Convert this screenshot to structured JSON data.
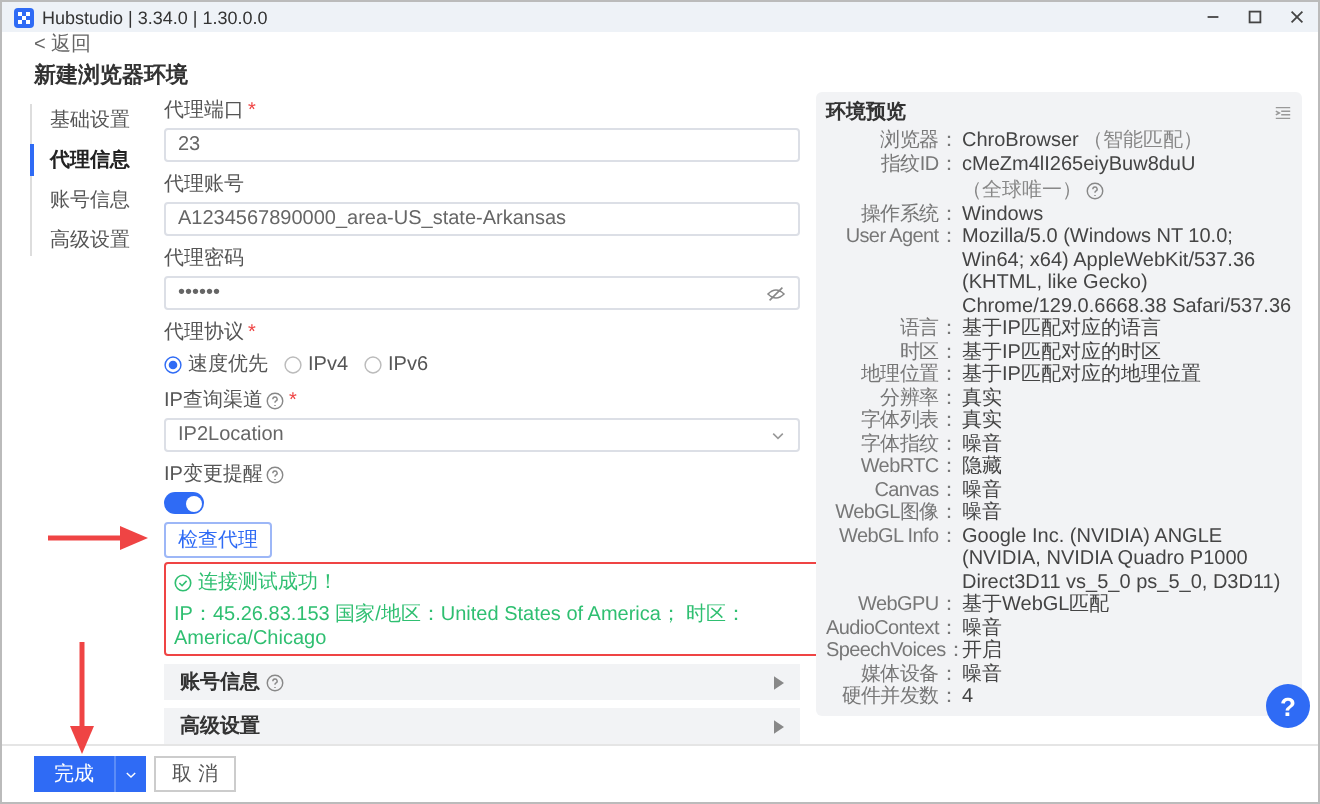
{
  "window": {
    "title": "Hubstudio | 3.34.0 | 1.30.0.0"
  },
  "back_link": "< 返回",
  "page_title": "新建浏览器环境",
  "nav": [
    {
      "label": "基础设置",
      "selected": false
    },
    {
      "label": "代理信息",
      "selected": true
    },
    {
      "label": "账号信息",
      "selected": false
    },
    {
      "label": "高级设置",
      "selected": false
    }
  ],
  "form": {
    "fields": [
      {
        "kind": "input",
        "label": "代理端口",
        "required_mark": "*",
        "value": "23"
      },
      {
        "kind": "input",
        "label": "代理账号",
        "value": "A1234567890000_area-US_state-Arkansas"
      },
      {
        "kind": "password",
        "label": "代理密码",
        "value": "••••••"
      },
      {
        "kind": "radio",
        "label": "代理协议",
        "required_mark": "*",
        "options": [
          {
            "label": "速度优先",
            "selected": true
          },
          {
            "label": "IPv4",
            "selected": false
          },
          {
            "label": "IPv6",
            "selected": false
          }
        ]
      },
      {
        "kind": "select",
        "label": "IP查询渠道",
        "help": true,
        "required_mark": "*",
        "value": "IP2Location"
      },
      {
        "kind": "toggle",
        "label": "IP变更提醒",
        "help": true,
        "on": true
      }
    ],
    "check_button": "检查代理",
    "check_result": {
      "status": "连接测试成功！",
      "details": "IP：45.26.83.153 国家/地区：United States of America； 时区：America/Chicago"
    },
    "sections": [
      {
        "title": "账号信息",
        "help": true,
        "expanded": false
      },
      {
        "title": "高级设置",
        "expanded": false
      }
    ]
  },
  "preview": {
    "title": "环境预览",
    "rows": [
      {
        "label": "浏览器：",
        "value": "ChroBrowser",
        "note": "（智能匹配）"
      },
      {
        "label": "指纹ID：",
        "value": "cMeZm4lI265eiyBuw8duU",
        "note": "（全球唯一）",
        "help": true
      },
      {
        "label": "操作系统：",
        "value": "Windows"
      },
      {
        "label": "User Agent：",
        "value": "Mozilla/5.0 (Windows NT 10.0; Win64; x64) AppleWebKit/537.36 (KHTML, like Gecko) Chrome/129.0.6668.38 Safari/537.36"
      },
      {
        "label": "语言：",
        "value": "基于IP匹配对应的语言"
      },
      {
        "label": "时区：",
        "value": "基于IP匹配对应的时区"
      },
      {
        "label": "地理位置：",
        "value": "基于IP匹配对应的地理位置"
      },
      {
        "label": "分辨率：",
        "value": "真实"
      },
      {
        "label": "字体列表：",
        "value": "真实"
      },
      {
        "label": "字体指纹：",
        "value": "噪音"
      },
      {
        "label": "WebRTC：",
        "value": "隐藏"
      },
      {
        "label": "Canvas：",
        "value": "噪音"
      },
      {
        "label": "WebGL图像：",
        "value": "噪音"
      },
      {
        "label": "WebGL Info：",
        "value": "Google Inc. (NVIDIA) ANGLE (NVIDIA, NVIDIA Quadro P1000 Direct3D11 vs_5_0 ps_5_0, D3D11)"
      },
      {
        "label": "WebGPU：",
        "value": "基于WebGL匹配"
      },
      {
        "label": "AudioContext：",
        "value": "噪音"
      },
      {
        "label": "SpeechVoices：",
        "value": "开启"
      },
      {
        "label": "媒体设备：",
        "value": "噪音"
      },
      {
        "label": "硬件并发数：",
        "value": "4"
      }
    ]
  },
  "help_button": "?",
  "footer": {
    "buttons": [
      {
        "label": "完成",
        "kind": "primary"
      },
      {
        "label": "取 消",
        "kind": "default"
      }
    ]
  }
}
